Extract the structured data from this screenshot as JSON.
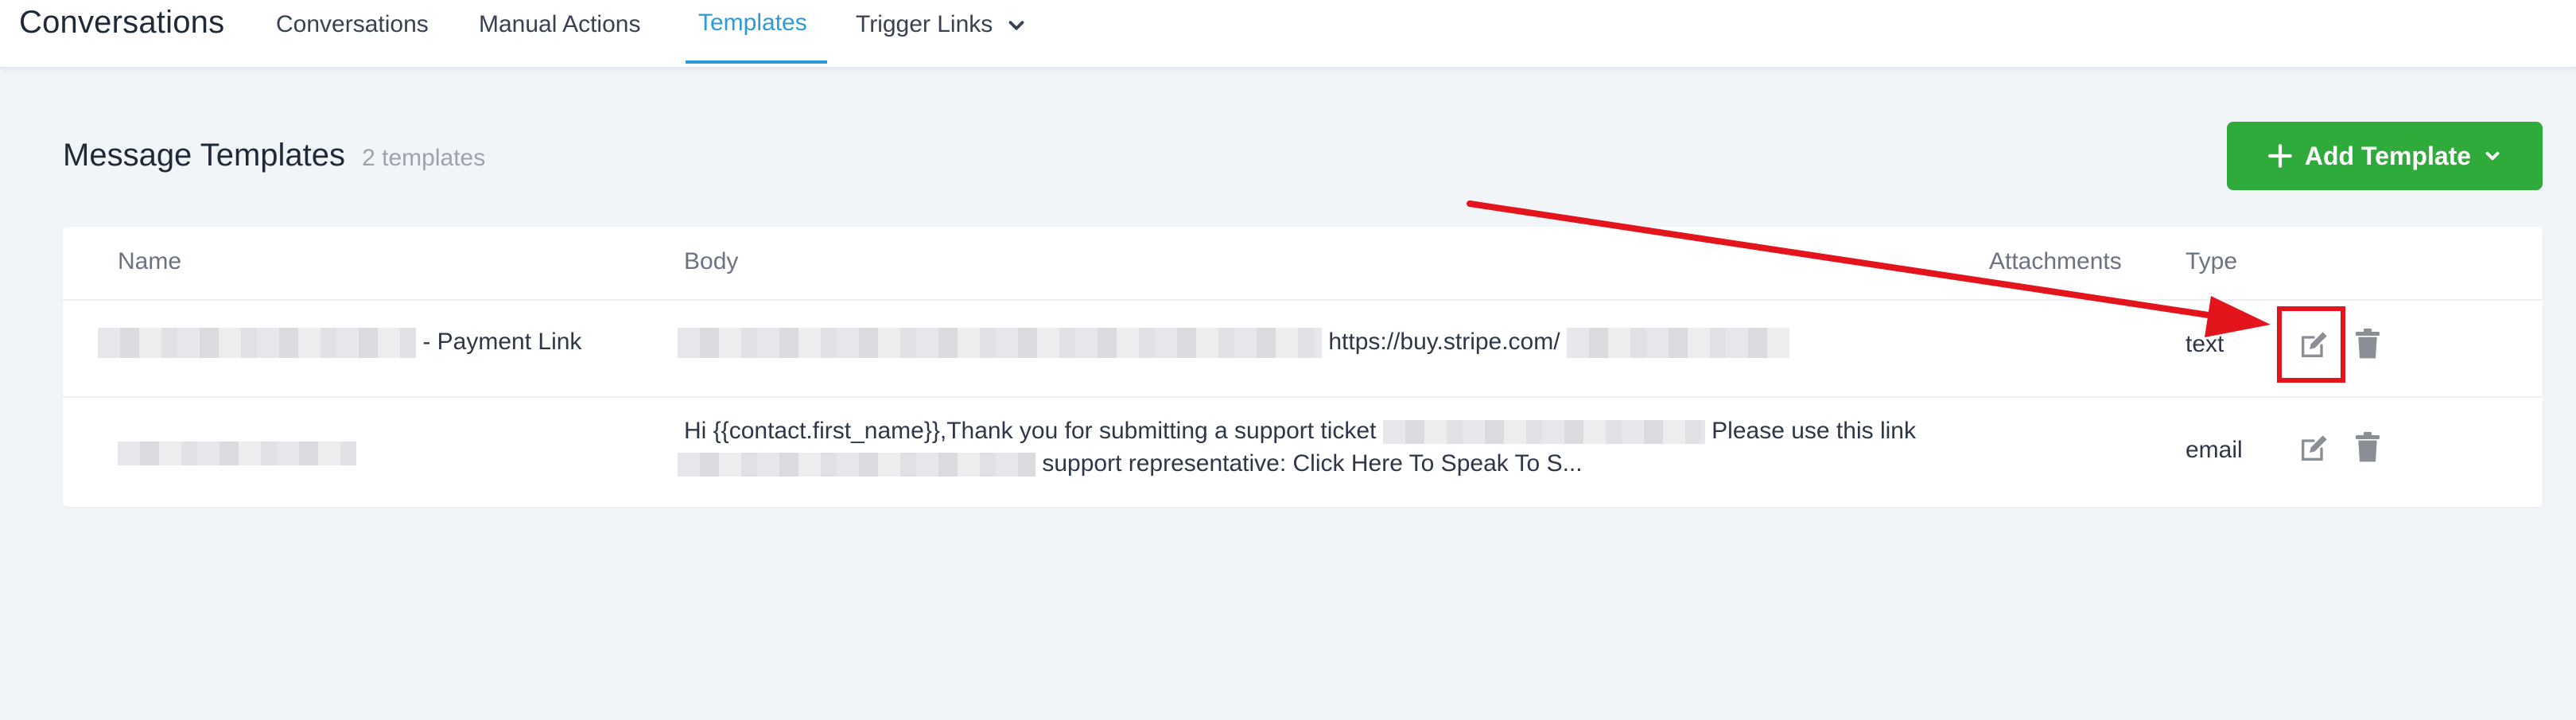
{
  "nav": {
    "app_title": "Conversations",
    "tabs": [
      {
        "label": "Conversations"
      },
      {
        "label": "Manual Actions"
      },
      {
        "label": "Templates",
        "active": true
      },
      {
        "label": "Trigger Links"
      }
    ],
    "chevron_icon": "chevron-down-icon"
  },
  "page": {
    "title": "Message Templates",
    "count": "2 templates"
  },
  "add_button": {
    "label": "Add Template",
    "icons": [
      "plus-icon",
      "chevron-down-icon"
    ],
    "color": "#2eab3b"
  },
  "table": {
    "headers": {
      "name": "Name",
      "body": "Body",
      "attachments": "Attachments",
      "type": "Type"
    },
    "rows": [
      {
        "name_suffix": "- Payment Link",
        "body_link": "https://buy.stripe.com/",
        "type": "text",
        "actions": [
          "edit-icon",
          "trash-icon"
        ]
      },
      {
        "body_line1": "Hi {{contact.first_name}},Thank you for submitting a support ticket",
        "body_line1_end": "Please use this link",
        "body_line2": "support representative: Click Here To Speak To S...",
        "type": "email",
        "actions": [
          "edit-icon",
          "trash-icon"
        ]
      }
    ]
  },
  "colors": {
    "accent": "#2b9ad6",
    "annotation": "#e3141b",
    "background": "#f1f5f8"
  }
}
